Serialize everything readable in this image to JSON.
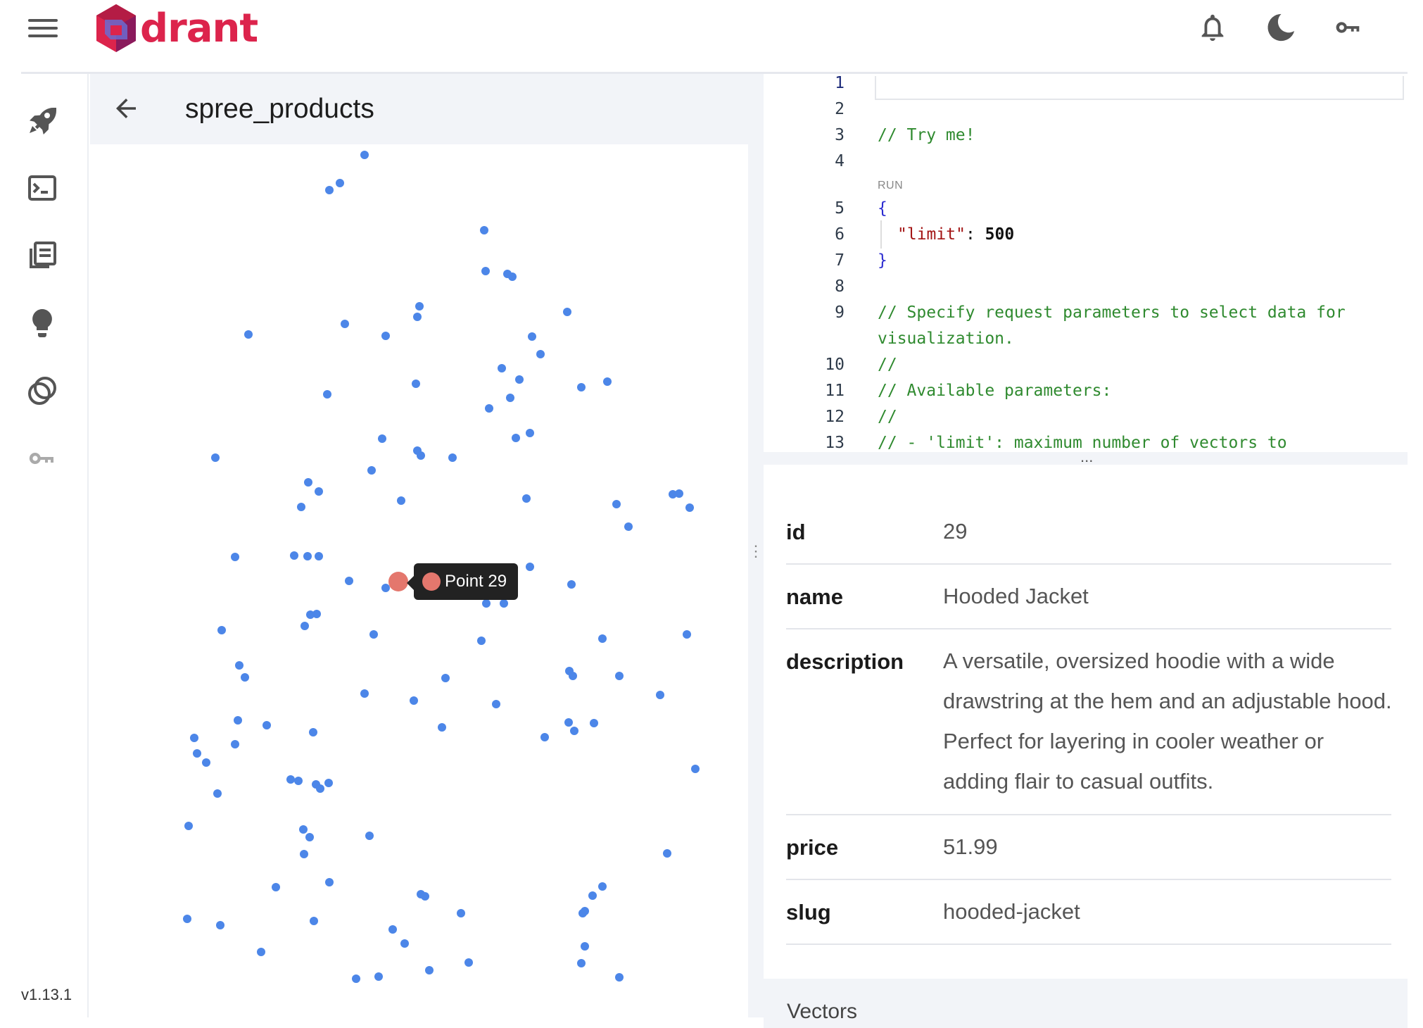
{
  "app": {
    "logo_text": "drant",
    "version": "v1.13.1",
    "top_icons": [
      "bell-icon",
      "moon-icon",
      "key-icon"
    ],
    "brand_color": "#dc244c"
  },
  "sidebar": {
    "items": [
      {
        "icon": "rocket-icon"
      },
      {
        "icon": "console-icon"
      },
      {
        "icon": "collections-icon"
      },
      {
        "icon": "lightbulb-icon"
      },
      {
        "icon": "datasets-icon"
      },
      {
        "icon": "key-icon"
      }
    ]
  },
  "collection": {
    "title": "spree_products"
  },
  "scatter": {
    "point_color": "#4c86e8",
    "highlight_color": "#e4776d",
    "tooltip_label": "Point 29"
  },
  "editor": {
    "run_label": "RUN",
    "lines": [
      {
        "n": "1",
        "text": ""
      },
      {
        "n": "2",
        "text": ""
      },
      {
        "n": "3",
        "text": "// Try me!"
      },
      {
        "n": "4",
        "text": ""
      },
      {
        "n": "5",
        "text": "{"
      },
      {
        "n": "6",
        "text": "\"limit\": 500"
      },
      {
        "n": "7",
        "text": "}"
      },
      {
        "n": "8",
        "text": ""
      },
      {
        "n": "9",
        "text": "// Specify request parameters to select data for"
      },
      {
        "n": "",
        "text": "visualization."
      },
      {
        "n": "10",
        "text": "//"
      },
      {
        "n": "11",
        "text": "// Available parameters:"
      },
      {
        "n": "12",
        "text": "//"
      },
      {
        "n": "13",
        "text": "// - 'limit': maximum number of vectors to"
      }
    ],
    "handle": "..."
  },
  "details": {
    "fields": [
      {
        "key": "id",
        "value": "29"
      },
      {
        "key": "name",
        "value": "Hooded Jacket"
      },
      {
        "key": "description",
        "value": "A versatile, oversized hoodie with a wide drawstring at the hem and an adjustable hood. Perfect for layering in cooler weather or adding flair to casual outfits."
      },
      {
        "key": "price",
        "value": "51.99"
      },
      {
        "key": "slug",
        "value": "hooded-jacket"
      }
    ],
    "next_section_label": "Vectors"
  }
}
